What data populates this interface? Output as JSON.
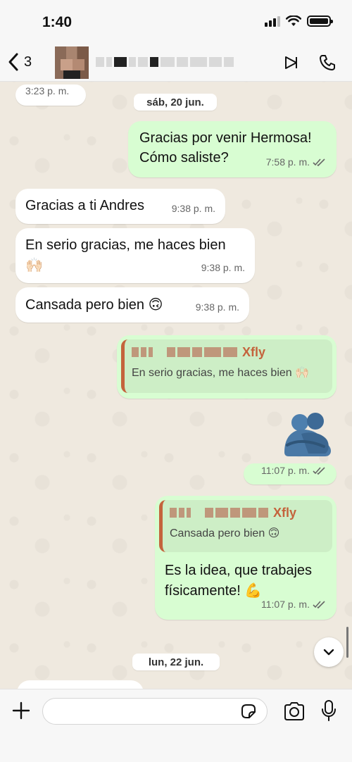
{
  "status_bar": {
    "time": "1:40"
  },
  "header": {
    "back_count": "3"
  },
  "chat": {
    "prev_time": "3:23 p. m.",
    "date_1": "sáb, 20 jun.",
    "date_2": "lun, 22 jun.",
    "messages": [
      {
        "text_1": "Gracias por venir Hermosa!",
        "text_2": "Cómo saliste?",
        "time": "7:58 p. m."
      },
      {
        "text": "Gracias a ti Andres",
        "time": "9:38 p. m."
      },
      {
        "text": "En serio gracias, me haces bien",
        "emoji": "🙌🏻",
        "time": "9:38 p. m."
      },
      {
        "text": "Cansada pero bien",
        "emoji": "🙃",
        "time": "9:38 p. m."
      },
      {
        "quote_author": "Xfly",
        "quote_text": "En serio gracias, me haces bien 🙌🏻"
      },
      {
        "time": "11:07 p. m."
      },
      {
        "quote_author": "Xfly",
        "quote_text": "Cansada pero bien 🙃",
        "text_1": "Es la idea, que trabajes",
        "text_2": "físicamente!",
        "emoji": "💪",
        "time": "11:07 p. m."
      }
    ]
  },
  "input": {
    "placeholder": ""
  }
}
